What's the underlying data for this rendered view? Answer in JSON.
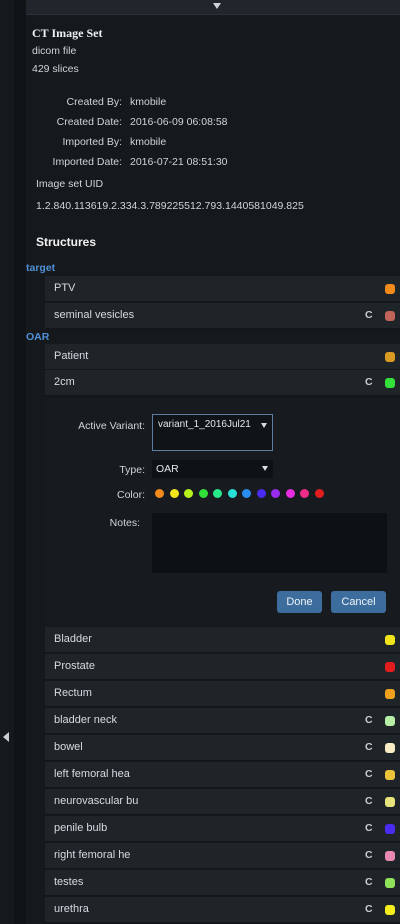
{
  "header": {
    "title": "CT Image Set",
    "file_type": "dicom file",
    "slices": "429 slices"
  },
  "details": {
    "created_by_label": "Created By:",
    "created_by": "kmobile",
    "created_date_label": "Created Date:",
    "created_date": "2016-06-09 06:08:58",
    "imported_by_label": "Imported By:",
    "imported_by": "kmobile",
    "imported_date_label": "Imported Date:",
    "imported_date": "2016-07-21 08:51:30",
    "uid_label": "Image set UID",
    "uid": "1.2.840.113619.2.334.3.789225512.793.1440581049.825"
  },
  "structures": {
    "title": "Structures",
    "group_target": "target",
    "group_oar": "OAR",
    "target_items": [
      {
        "label": "PTV",
        "c": "",
        "color": "#f28a1c"
      },
      {
        "label": "seminal vesicles",
        "c": "C",
        "color": "#c0645a"
      }
    ],
    "oar_top_items": [
      {
        "label": "Patient",
        "c": "",
        "color": "#d89a20"
      },
      {
        "label": "2cm",
        "c": "C",
        "color": "#33e03a"
      }
    ],
    "oar_items": [
      {
        "label": "Bladder",
        "c": "",
        "color": "#f2e51c"
      },
      {
        "label": "Prostate",
        "c": "",
        "color": "#e31d1d"
      },
      {
        "label": "Rectum",
        "c": "",
        "color": "#f0a11c"
      },
      {
        "label": "bladder neck",
        "c": "C",
        "color": "#b7efa6"
      },
      {
        "label": "bowel",
        "c": "C",
        "color": "#f8ecc4"
      },
      {
        "label": "left femoral hea",
        "c": "C",
        "color": "#ecc43a"
      },
      {
        "label": "neurovascular bu",
        "c": "C",
        "color": "#e7e37d"
      },
      {
        "label": "penile bulb",
        "c": "C",
        "color": "#4a2cf0"
      },
      {
        "label": "right femoral he",
        "c": "C",
        "color": "#e888b2"
      },
      {
        "label": "testes",
        "c": "C",
        "color": "#8fe25a"
      },
      {
        "label": "urethra",
        "c": "C",
        "color": "#f5ec1c"
      }
    ]
  },
  "editor": {
    "active_variant_label": "Active Variant:",
    "active_variant_value": "variant_1_2016Jul21",
    "type_label": "Type:",
    "type_value": "OAR",
    "color_label": "Color:",
    "notes_label": "Notes:",
    "notes_value": "",
    "palette": [
      "#f28a1c",
      "#f2e51c",
      "#b8f21c",
      "#33e03a",
      "#28e88a",
      "#28e0d8",
      "#2a8cf0",
      "#4a2cf0",
      "#9a2cf0",
      "#e82ce0",
      "#f02c8a",
      "#e31d1d"
    ],
    "done_label": "Done",
    "cancel_label": "Cancel"
  }
}
